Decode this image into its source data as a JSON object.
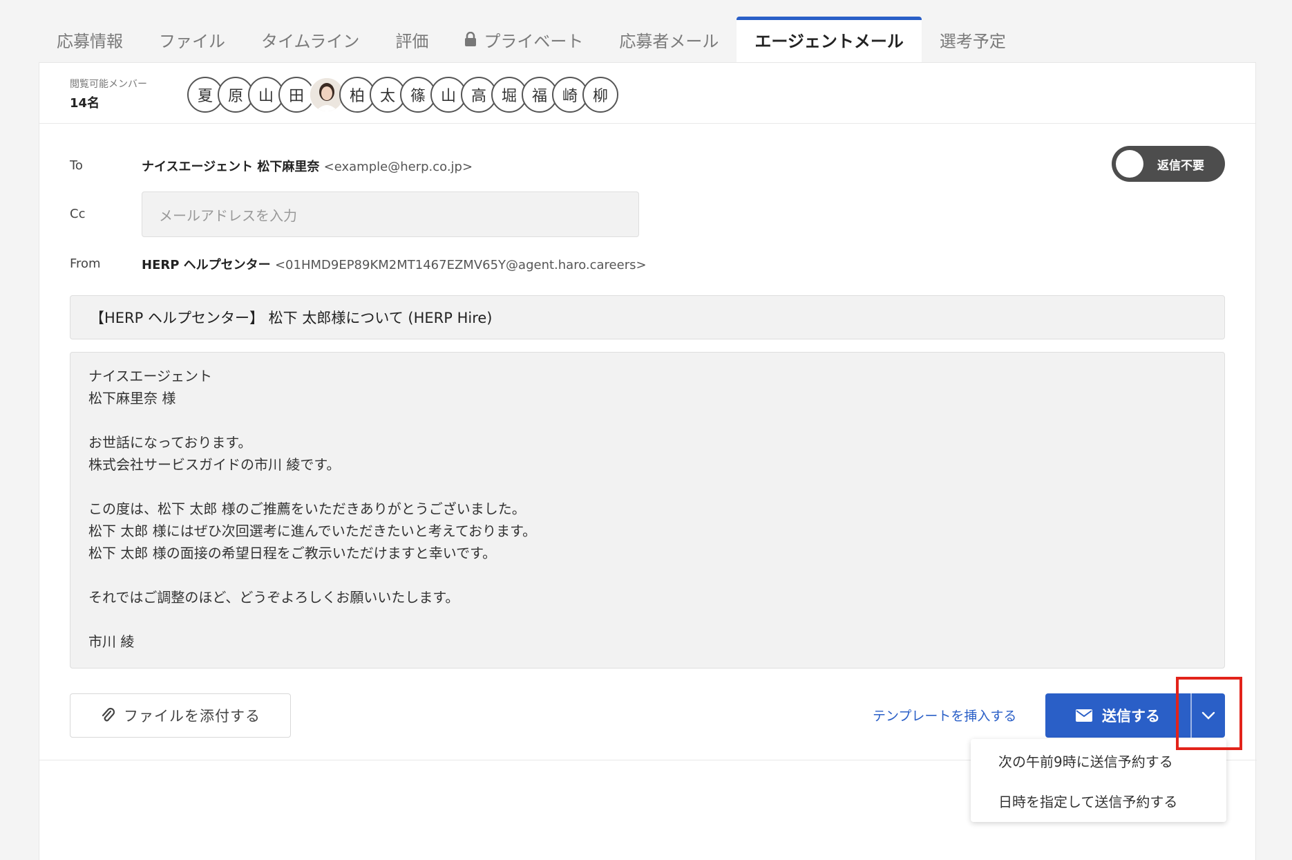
{
  "tabs": [
    {
      "label": "応募情報"
    },
    {
      "label": "ファイル"
    },
    {
      "label": "タイムライン"
    },
    {
      "label": "評価"
    },
    {
      "label": "プライベート",
      "icon": "lock-icon"
    },
    {
      "label": "応募者メール"
    },
    {
      "label": "エージェントメール",
      "active": true
    },
    {
      "label": "選考予定"
    }
  ],
  "members": {
    "label": "閲覧可能メンバー",
    "count": "14名",
    "avatars": [
      "夏",
      "原",
      "山",
      "田",
      "",
      "柏",
      "太",
      "篠",
      "山",
      "高",
      "堀",
      "福",
      "崎",
      "柳"
    ]
  },
  "to": {
    "label": "To",
    "name": "ナイスエージェント 松下麻里奈",
    "email": "<example@herp.co.jp>"
  },
  "reply_toggle": {
    "label": "返信不要",
    "on": false
  },
  "cc": {
    "label": "Cc",
    "placeholder": "メールアドレスを入力"
  },
  "from": {
    "label": "From",
    "name": "HERP ヘルプセンター",
    "email": "<01HMD9EP89KM2MT1467EZMV65Y@agent.haro.careers>"
  },
  "subject": "【HERP ヘルプセンター】 松下 太郎様について (HERP Hire)",
  "body_lines": [
    "ナイスエージェント",
    "松下麻里奈 様",
    "",
    "お世話になっております。",
    "株式会社サービスガイドの市川 綾です。",
    "",
    "この度は、松下 太郎 様のご推薦をいただきありがとうございました。",
    "松下 太郎 様にはぜひ次回選考に進んでいただきたいと考えております。",
    "松下 太郎 様の面接の希望日程をご教示いただけますと幸いです。",
    "",
    "それではご調整のほど、どうぞよろしくお願いいたします。",
    "",
    "市川 綾"
  ],
  "actions": {
    "attach_label": "ファイルを添付する",
    "template_label": "テンプレートを挿入する",
    "send_label": "送信する"
  },
  "schedule_menu": [
    {
      "label": "次の午前9時に送信予約する"
    },
    {
      "label": "日時を指定して送信予約する"
    }
  ],
  "colors": {
    "accent": "#2a5fc7",
    "highlight": "#e2231a"
  }
}
